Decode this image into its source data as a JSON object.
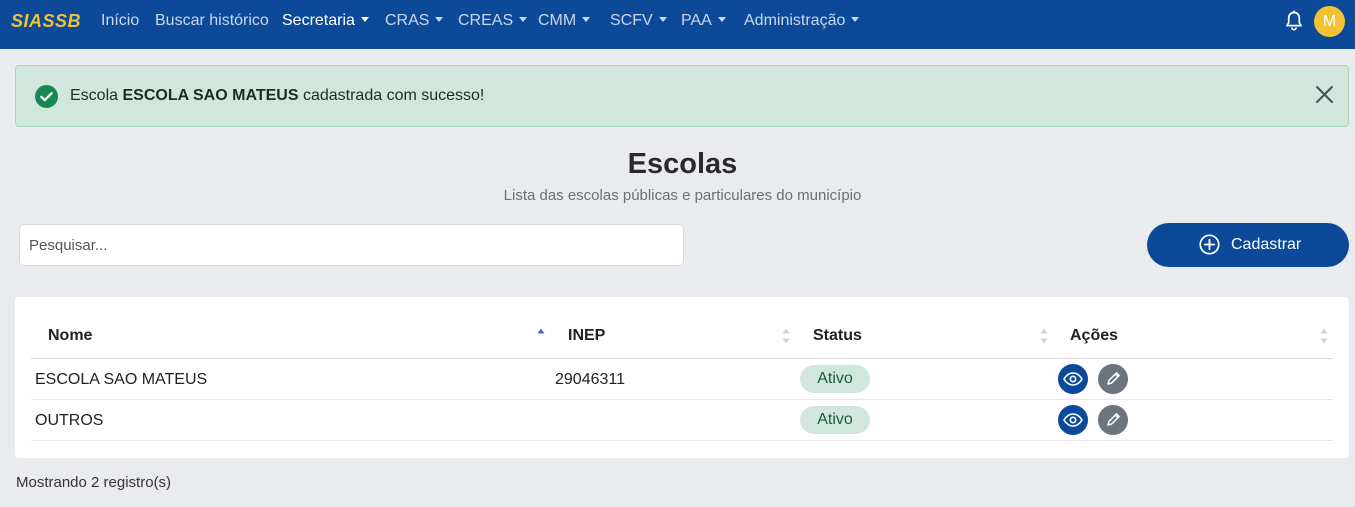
{
  "navbar": {
    "brand": "SIASSB",
    "items": [
      {
        "label": "Início",
        "dropdown": false
      },
      {
        "label": "Buscar histórico",
        "dropdown": false
      },
      {
        "label": "Secretaria",
        "dropdown": true,
        "active": true
      },
      {
        "label": "CRAS",
        "dropdown": true
      },
      {
        "label": "CREAS",
        "dropdown": true
      },
      {
        "label": "CMM",
        "dropdown": true
      },
      {
        "label": "SCFV",
        "dropdown": true
      },
      {
        "label": "PAA",
        "dropdown": true
      },
      {
        "label": "Administração",
        "dropdown": true
      }
    ],
    "notification_icon": "bell-icon",
    "avatar_initial": "M"
  },
  "alert": {
    "prefix": "Escola",
    "school_name": "ESCOLA SAO MATEUS",
    "suffix": "cadastrada com sucesso!",
    "icon": "check-circle-icon",
    "close_icon": "close-icon"
  },
  "page": {
    "title": "Escolas",
    "subtitle": "Lista das escolas públicas e particulares do município"
  },
  "search": {
    "placeholder": "Pesquisar...",
    "value": ""
  },
  "add_button": {
    "label": "Cadastrar",
    "icon": "plus-circle-icon"
  },
  "table": {
    "columns": [
      "Nome",
      "INEP",
      "Status",
      "Ações"
    ],
    "sorted_column": "Nome",
    "sort_direction": "asc",
    "rows": [
      {
        "nome": "ESCOLA SAO MATEUS",
        "inep": "29046311",
        "status": "Ativo"
      },
      {
        "nome": "OUTROS",
        "inep": "",
        "status": "Ativo"
      }
    ],
    "row_actions": [
      "eye-icon",
      "pencil-icon"
    ]
  },
  "footer": {
    "records_text": "Mostrando 2 registro(s)"
  },
  "colors": {
    "navbar": "#0c4a99",
    "brand": "#f2c230",
    "alert_bg": "#d1e7dd",
    "badge_bg": "#d1e7dd",
    "view_button": "#0c4a99",
    "edit_button": "#6c757d",
    "page_bg": "#e9ebef"
  }
}
